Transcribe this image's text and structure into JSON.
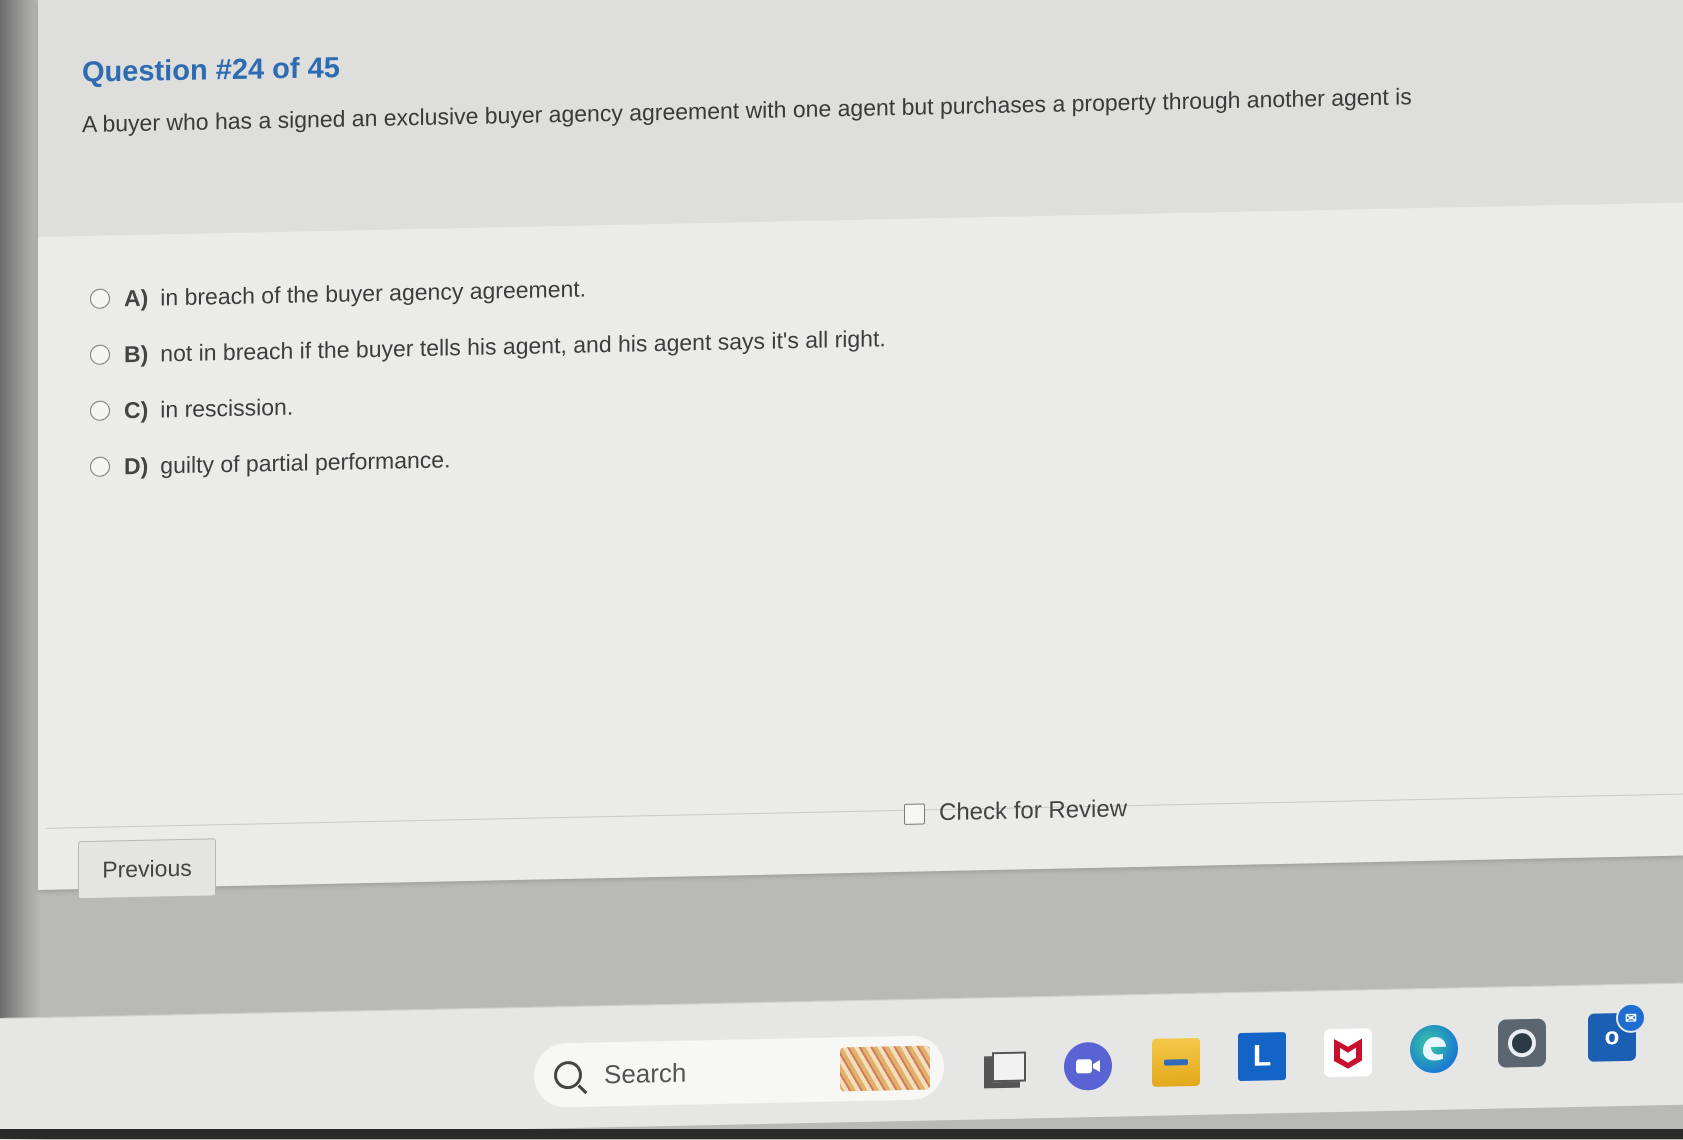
{
  "question": {
    "title": "Question #24 of 45",
    "text": "A buyer who has a signed an exclusive buyer agency agreement with one agent but purchases a property through another agent is"
  },
  "options": [
    {
      "letter": "A)",
      "text": "in breach of the buyer agency agreement."
    },
    {
      "letter": "B)",
      "text": "not in breach if the buyer tells his agent, and his agent says it's all right."
    },
    {
      "letter": "C)",
      "text": "in rescission."
    },
    {
      "letter": "D)",
      "text": "guilty of partial performance."
    }
  ],
  "footer": {
    "previous_label": "Previous",
    "review_label": "Check for Review"
  },
  "taskbar": {
    "search_label": "Search",
    "icons": [
      "windows-start-icon",
      "search-icon",
      "task-view-icon",
      "meet-icon",
      "file-explorer-icon",
      "l-app-icon",
      "mcafee-icon",
      "edge-icon",
      "camera-icon",
      "outlook-icon"
    ],
    "l_app_letter": "L",
    "outlook_letter": "o"
  }
}
